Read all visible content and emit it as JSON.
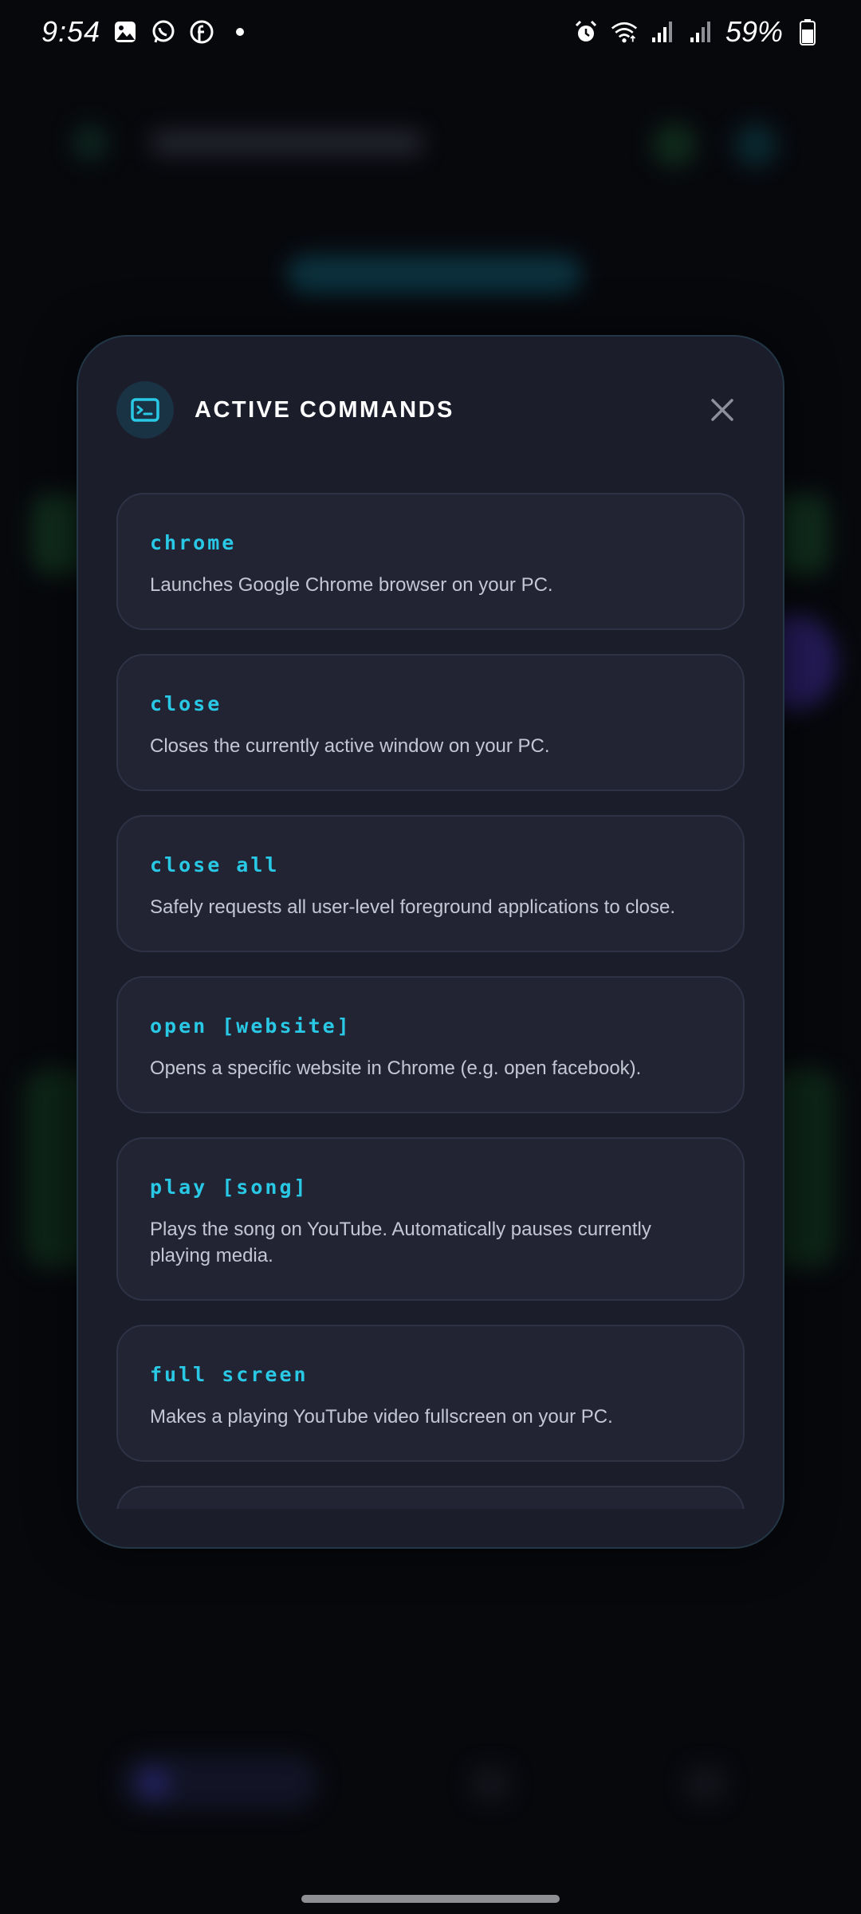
{
  "status_bar": {
    "time": "9:54",
    "battery": "59%",
    "left_icons": [
      "gallery-icon",
      "whatsapp-icon",
      "facebook-icon",
      "dot-icon"
    ],
    "right_icons": [
      "alarm-icon",
      "wifi-icon",
      "signal-icon",
      "signal-icon",
      "battery-icon"
    ]
  },
  "modal": {
    "title": "ACTIVE COMMANDS",
    "header_icon": "terminal-icon",
    "close_icon": "close-icon",
    "accent_color": "#29c9e6",
    "commands": [
      {
        "name": "chrome",
        "description": "Launches Google Chrome browser on your PC."
      },
      {
        "name": "close",
        "description": "Closes the currently active window on your PC."
      },
      {
        "name": "close all",
        "description": "Safely requests all user-level foreground applications to close."
      },
      {
        "name": "open [website]",
        "description": "Opens a specific website in Chrome (e.g. open facebook)."
      },
      {
        "name": "play [song]",
        "description": "Plays the song on YouTube. Automatically pauses currently playing media."
      },
      {
        "name": "full screen",
        "description": "Makes a playing YouTube video fullscreen on your PC."
      }
    ]
  }
}
